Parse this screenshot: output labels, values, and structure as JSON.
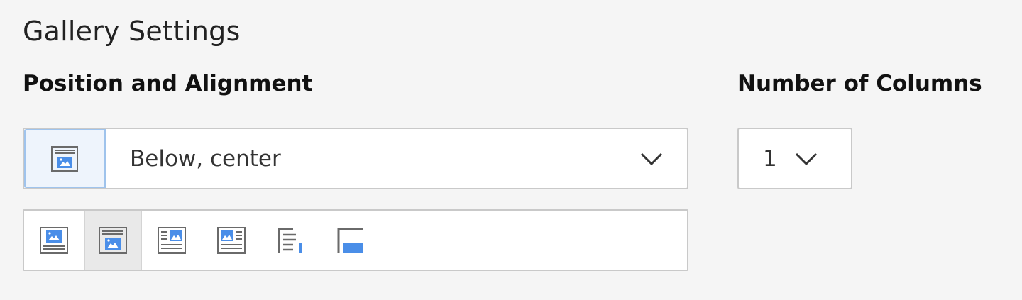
{
  "section": {
    "title": "Gallery Settings"
  },
  "position": {
    "label": "Position and Alignment",
    "selected_value": "Below, center",
    "selected_icon": "below-center-icon",
    "options": [
      {
        "icon": "above-center-icon",
        "active": false
      },
      {
        "icon": "below-center-icon",
        "active": true
      },
      {
        "icon": "above-right-icon",
        "active": false
      },
      {
        "icon": "above-left-icon",
        "active": false
      },
      {
        "icon": "intext-right-icon",
        "active": false
      },
      {
        "icon": "intext-left-icon",
        "active": false
      }
    ]
  },
  "columns": {
    "label": "Number of Columns",
    "selected_value": "1"
  },
  "colors": {
    "accent_blue": "#4a8ee8",
    "icon_gray": "#6a6a6a",
    "active_icon_bg": "#eef4fc",
    "active_option_bg": "#e9e9e9"
  }
}
